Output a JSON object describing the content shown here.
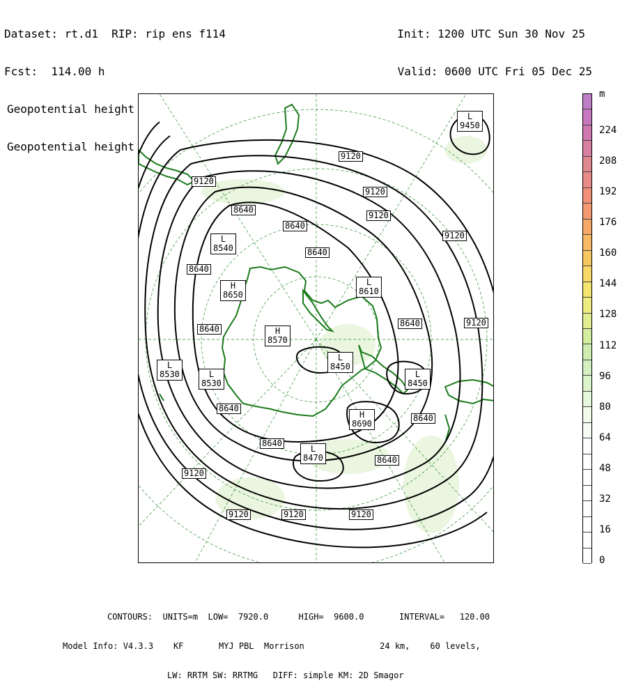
{
  "header": {
    "dataset": "Dataset: rt.d1",
    "rip": "RIP: rip ens f114",
    "fcst": "Fcst:  114.00 h",
    "field1": "Geopotential height",
    "field2": "Geopotential height",
    "init": "Init: 1200 UTC Sun 30 Nov 25",
    "valid": "Valid: 0600 UTC Fri 05 Dec 25"
  },
  "map": {
    "contour_labels": [
      {
        "text": "9120"
      },
      {
        "text": "9120"
      },
      {
        "text": "9120"
      },
      {
        "text": "9120"
      },
      {
        "text": "9120"
      },
      {
        "text": "9120"
      },
      {
        "text": "9120"
      },
      {
        "text": "9120"
      },
      {
        "text": "9120"
      },
      {
        "text": "9120"
      },
      {
        "text": "8640"
      },
      {
        "text": "8640"
      },
      {
        "text": "8640"
      },
      {
        "text": "8640"
      },
      {
        "text": "8640"
      },
      {
        "text": "8640"
      },
      {
        "text": "8640"
      },
      {
        "text": "8640"
      },
      {
        "text": "8640"
      },
      {
        "text": "8640"
      }
    ],
    "extrema": [
      {
        "kind": "L",
        "value": "9450"
      },
      {
        "kind": "L",
        "value": "8540"
      },
      {
        "kind": "H",
        "value": "8650"
      },
      {
        "kind": "L",
        "value": "8610"
      },
      {
        "kind": "H",
        "value": "8570"
      },
      {
        "kind": "L",
        "value": "8450"
      },
      {
        "kind": "L",
        "value": "8530"
      },
      {
        "kind": "L",
        "value": "8530"
      },
      {
        "kind": "L",
        "value": "8450"
      },
      {
        "kind": "H",
        "value": "8690"
      },
      {
        "kind": "L",
        "value": "8470"
      }
    ],
    "colors": {
      "coast": "#1a7a1a",
      "contour": "#000000",
      "grid": "#2a8a2a",
      "shade": "#e8f5dc"
    }
  },
  "colorbar": {
    "unit": "m",
    "ticks": [
      "224",
      "208",
      "192",
      "176",
      "160",
      "144",
      "128",
      "112",
      "96",
      "80",
      "64",
      "48",
      "32",
      "16",
      "0"
    ]
  },
  "footer": {
    "line1": "CONTOURS:  UNITS=m  LOW=  7920.0      HIGH=  9600.0       INTERVAL=   120.00",
    "line2": "Model Info: V4.3.3    KF       MYJ PBL  Morrison               24 km,    60 levels,",
    "line3": "LW: RRTM SW: RRTMG   DIFF: simple KM: 2D Smagor"
  }
}
